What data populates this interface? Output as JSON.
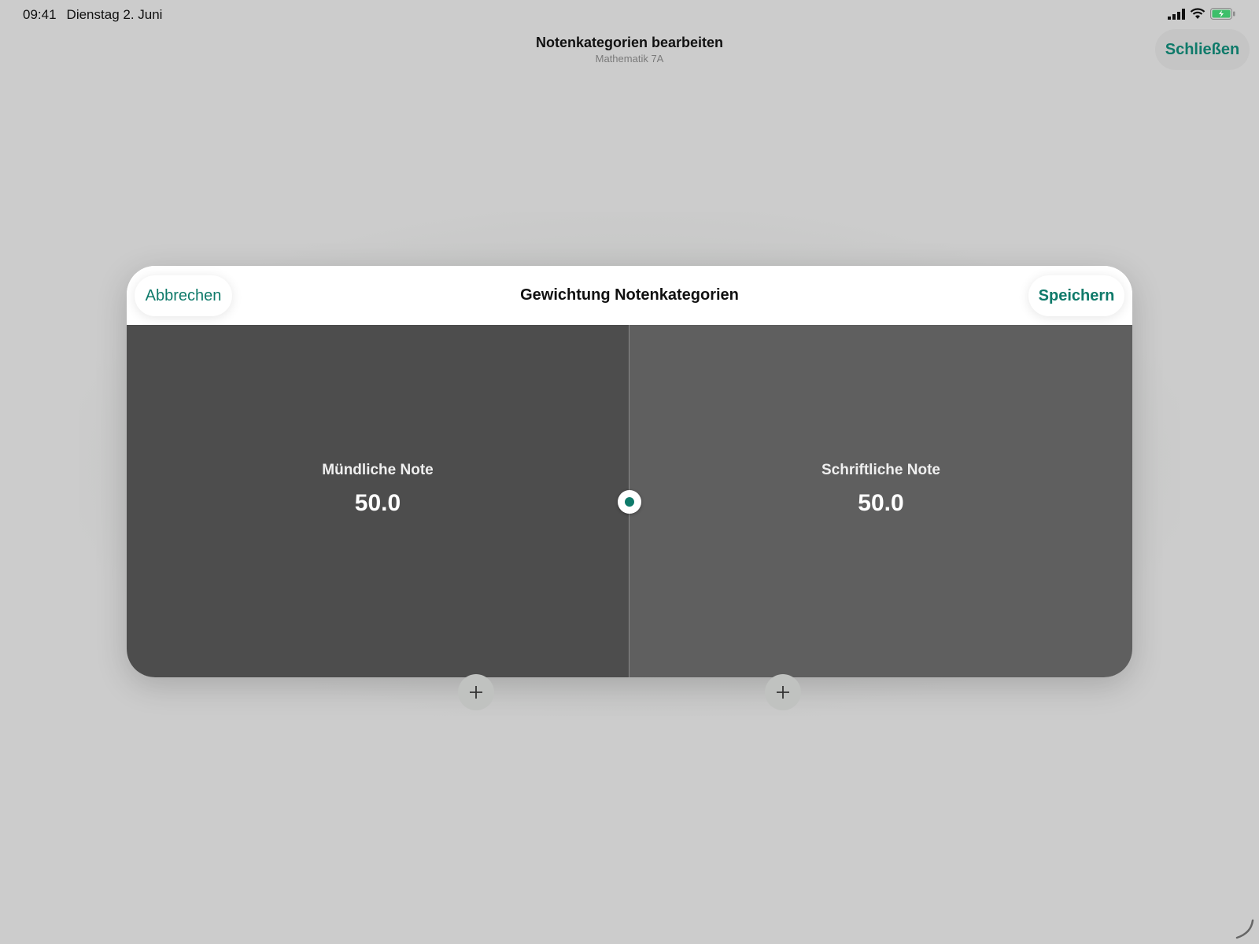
{
  "status_bar": {
    "time": "09:41",
    "date": "Dienstag 2. Juni"
  },
  "nav": {
    "title": "Notenkategorien bearbeiten",
    "subtitle": "Mathematik 7A",
    "close_label": "Schließen"
  },
  "modal": {
    "title": "Gewichtung Notenkategorien",
    "cancel_label": "Abbrechen",
    "save_label": "Speichern",
    "categories": [
      {
        "label": "Mündliche Note",
        "value": "50.0"
      },
      {
        "label": "Schriftliche Note",
        "value": "50.0"
      }
    ]
  },
  "colors": {
    "accent": "#0f7a6a",
    "background": "#cccccc",
    "panel_left": "#4d4d4d",
    "panel_right": "#5f5f5f"
  },
  "icons": [
    "signal-icon",
    "wifi-icon",
    "battery-icon",
    "plus-icon"
  ]
}
